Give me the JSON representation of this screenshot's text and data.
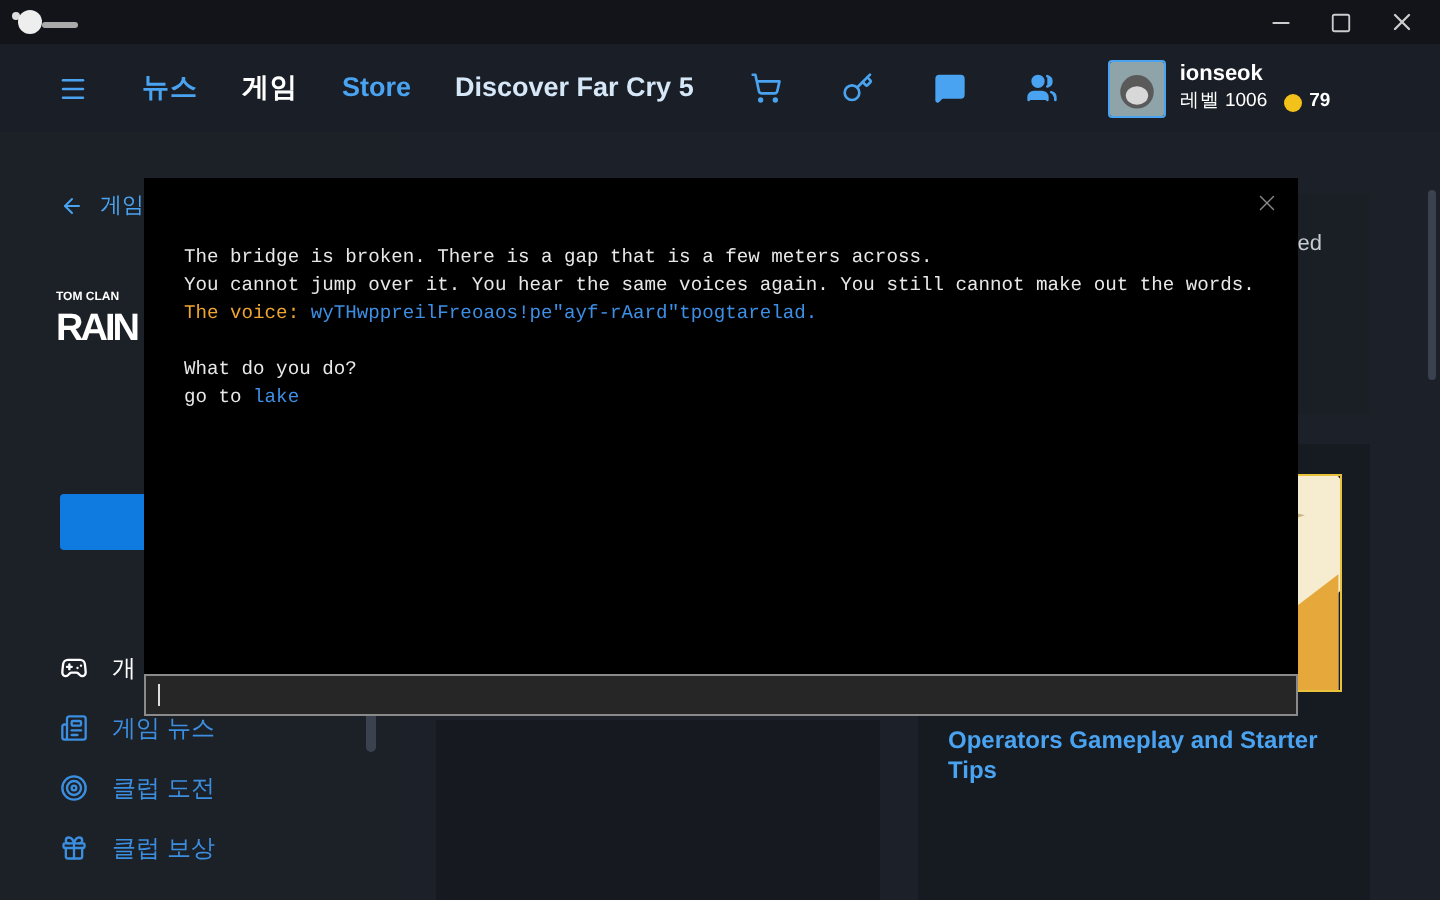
{
  "nav": {
    "tabs": [
      {
        "label": "뉴스",
        "selected": false
      },
      {
        "label": "게임",
        "selected": true
      },
      {
        "label": "Store",
        "selected": false
      },
      {
        "label": "Discover Far Cry 5",
        "selected": false
      }
    ],
    "user": {
      "name": "ionseok",
      "level": "레벨 1006",
      "coins": "79"
    }
  },
  "sidebar": {
    "back": "게임",
    "logo_small": "TOM CLAN",
    "logo": "RAIN",
    "items": [
      {
        "label": "개",
        "kind": "overview"
      },
      {
        "label": "게임 뉴스",
        "kind": "news"
      },
      {
        "label": "클럽 도전",
        "kind": "challenge"
      },
      {
        "label": "클럽 보상",
        "kind": "reward"
      }
    ]
  },
  "right": {
    "panel_text": "ed",
    "article_title": "Operators Gameplay and Starter Tips"
  },
  "console": {
    "paragraphs": [
      [
        [
          {
            "text": "The bridge is broken. There is a gap that is a few meters across.",
            "kind": "narration"
          }
        ],
        [
          {
            "text": "You cannot jump over it. You hear the same voices again. You still cannot make out the words.",
            "kind": "narration"
          }
        ],
        [
          {
            "text": "The voice: ",
            "kind": "speaker"
          },
          {
            "text": "wyTHwppreilFreoaos!pe\"ayf-rAard\"tpogtarelad.",
            "kind": "speech"
          }
        ]
      ],
      [
        [
          {
            "text": "What do you do?",
            "kind": "narration"
          }
        ],
        [
          {
            "text": "go to ",
            "kind": "narration"
          },
          {
            "text": "lake",
            "kind": "keyword"
          }
        ]
      ]
    ]
  }
}
